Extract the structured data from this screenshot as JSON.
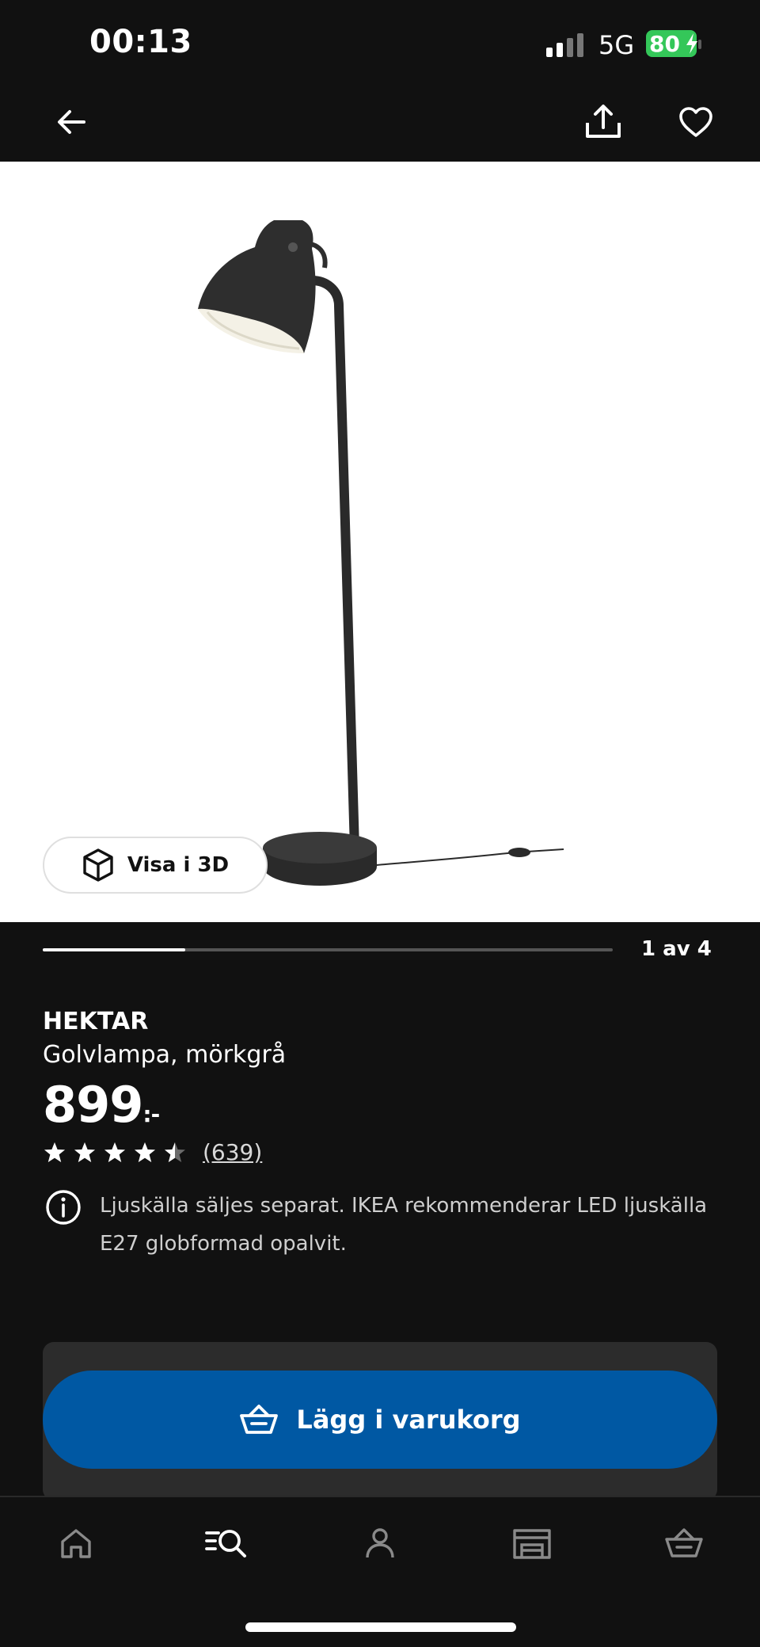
{
  "status_bar": {
    "time": "00:13",
    "network": "5G",
    "battery": "80",
    "battery_color": "#34c759"
  },
  "nav": {
    "back_icon": "arrow-left-icon",
    "share_icon": "share-icon",
    "favorite_icon": "heart-icon"
  },
  "gallery": {
    "view_3d_label": "Visa i 3D",
    "counter": "1 av 4",
    "progress": 0.25
  },
  "product": {
    "brand": "HEKTAR",
    "description": "Golvlampa, mörkgrå",
    "price": "899",
    "price_suffix": ":-",
    "rating": 4.5,
    "review_count": "(639)",
    "info_text": "Ljuskälla säljes separat. IKEA rekommenderar LED ljuskälla E27 globformad opalvit."
  },
  "cart": {
    "label": "Lägg i varukorg",
    "button_color": "#0058a3"
  },
  "tabbar": {
    "items": [
      {
        "icon": "home-icon"
      },
      {
        "icon": "search-icon",
        "active": true
      },
      {
        "icon": "profile-icon"
      },
      {
        "icon": "store-icon"
      },
      {
        "icon": "basket-icon"
      }
    ]
  }
}
